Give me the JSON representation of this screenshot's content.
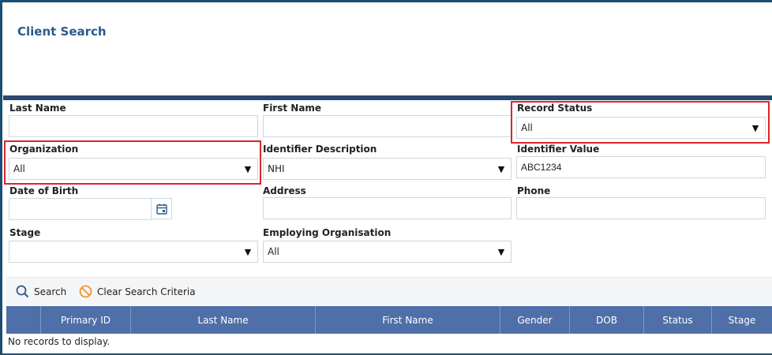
{
  "page": {
    "title": "Client Search"
  },
  "form": {
    "last_name": {
      "label": "Last Name",
      "value": ""
    },
    "first_name": {
      "label": "First Name",
      "value": ""
    },
    "record_status": {
      "label": "Record Status",
      "value": "All"
    },
    "organization": {
      "label": "Organization",
      "value": "All"
    },
    "identifier_description": {
      "label": "Identifier Description",
      "value": "NHI"
    },
    "identifier_value": {
      "label": "Identifier Value",
      "value": "ABC1234"
    },
    "date_of_birth": {
      "label": "Date of Birth",
      "value": ""
    },
    "address": {
      "label": "Address",
      "value": ""
    },
    "phone": {
      "label": "Phone",
      "value": ""
    },
    "stage": {
      "label": "Stage",
      "value": ""
    },
    "employing_organisation": {
      "label": "Employing Organisation",
      "value": "All"
    }
  },
  "toolbar": {
    "search_label": "Search",
    "clear_label": "Clear Search Criteria"
  },
  "grid": {
    "columns": [
      "Primary ID",
      "Last Name",
      "First Name",
      "Gender",
      "DOB",
      "Status",
      "Stage"
    ],
    "empty_message": "No records to display."
  },
  "icons": {
    "dropdown": "triangle-down-icon",
    "calendar": "calendar-icon",
    "search": "search-icon",
    "clear": "clear-icon"
  },
  "colors": {
    "title": "#2b5a8c",
    "band": "#2c4770",
    "grid_header": "#4f6fa8",
    "highlight": "#d9262b",
    "search_icon": "#2b5a8c",
    "clear_icon": "#f08a24"
  }
}
